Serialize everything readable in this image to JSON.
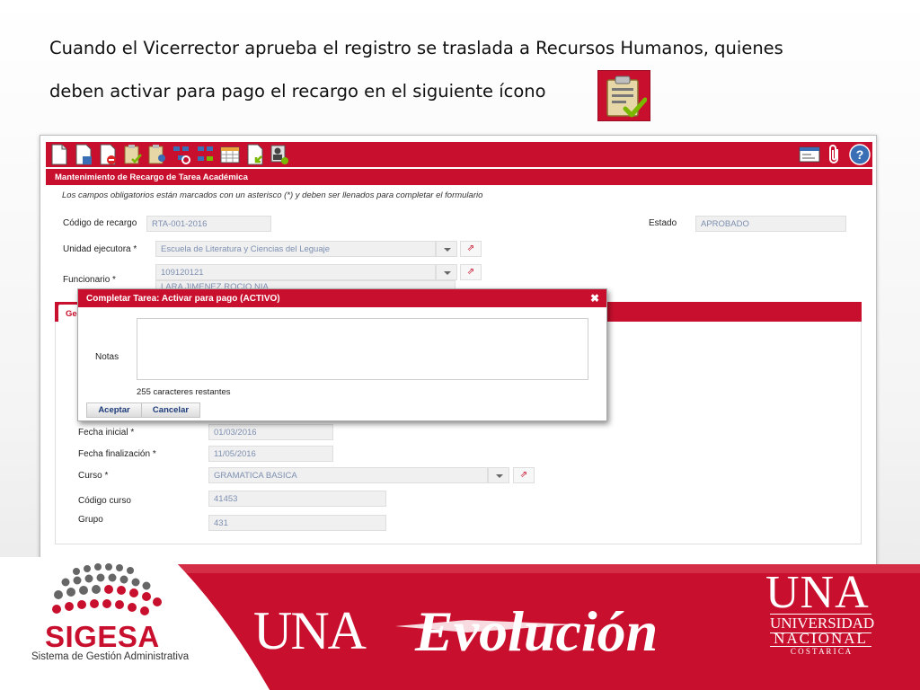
{
  "slide": {
    "line1": "Cuando el Vicerrector aprueba el registro se traslada a Recursos Humanos, quienes",
    "line2": "deben activar para pago el recargo  en el siguiente ícono",
    "icon": "clipboard-check-icon"
  },
  "app": {
    "panel_title": "Mantenimiento de Recargo de Tarea Académica",
    "hint": "Los campos obligatorios están marcados con un asterisco (*) y deben ser llenados para completar el formulario",
    "fields": {
      "codigo_label": "Código de recargo",
      "codigo_value": "RTA-001-2016",
      "estado_label": "Estado",
      "estado_value": "APROBADO",
      "unidad_label": "Unidad ejecutora *",
      "unidad_value": "Escuela de Literatura y Ciencias del Leguaje",
      "funcionario_label": "Funcionario *",
      "funcionario_value": "109120121",
      "funcionario_name": "LARA JIMENEZ ROCIO NIA",
      "fecha_inicial_label": "Fecha inicial *",
      "fecha_inicial_value": "01/03/2016",
      "fecha_final_label": "Fecha finalización *",
      "fecha_final_value": "11/05/2016",
      "curso_label": "Curso *",
      "curso_value": "GRAMATICA BASICA",
      "codigo_curso_label": "Código curso",
      "codigo_curso_value": "41453",
      "grupo_label": "Grupo",
      "grupo_value": "431"
    },
    "tab_label": "Ge",
    "link_glyph": "⇗"
  },
  "dialog": {
    "title": "Completar Tarea: Activar para pago (ACTIVO)",
    "close": "✖",
    "notes_label": "Notas",
    "notes_value": "",
    "remaining": "255 caracteres restantes",
    "accept": "Aceptar",
    "cancel": "Cancelar"
  },
  "footer": {
    "sigesa": "SIGESA",
    "sigesa_sub": "Sistema de Gestión Administrativa",
    "una_big": "UNA",
    "evolucion": "Evolución",
    "una_logo": "UNA",
    "una_l1": "UNIVERSIDAD",
    "una_l2": "NACIONAL",
    "una_l3": "C O S T A   R I C A"
  },
  "colors": {
    "brand_red": "#c8102e"
  }
}
